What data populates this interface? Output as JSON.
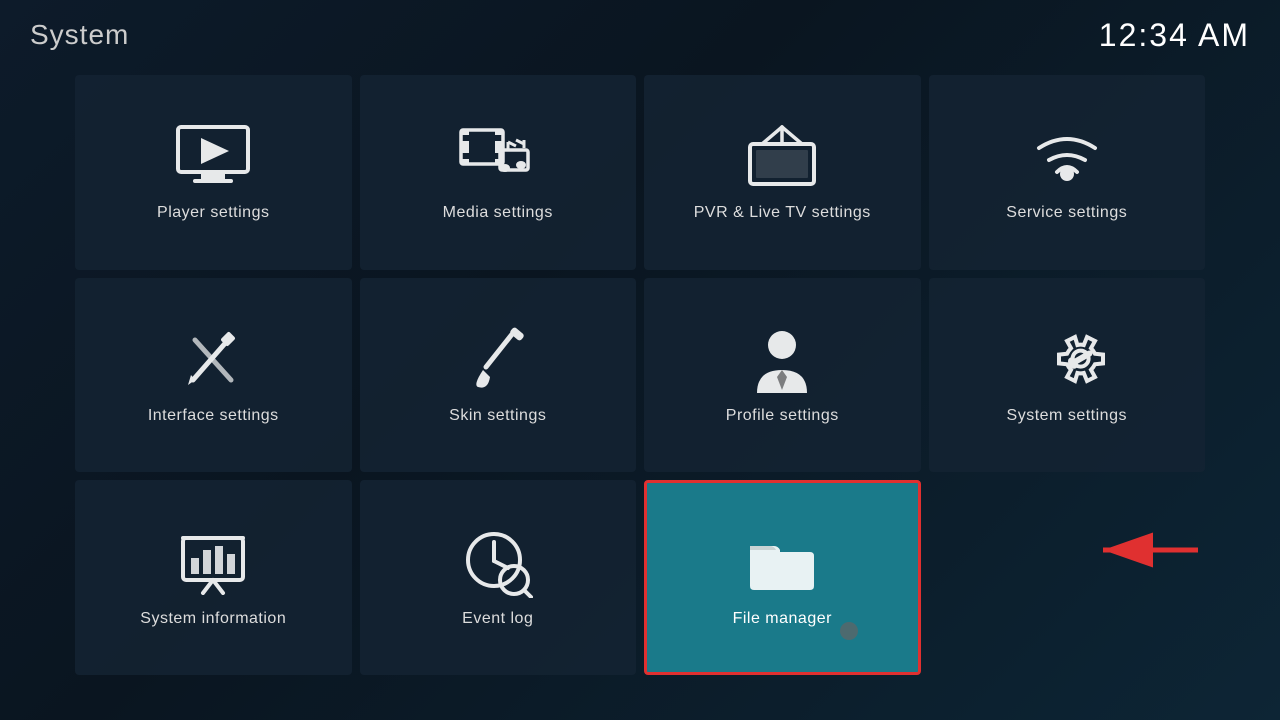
{
  "header": {
    "title": "System",
    "clock": "12:34 AM"
  },
  "tiles": [
    {
      "id": "player-settings",
      "label": "Player settings",
      "icon": "player",
      "highlighted": false
    },
    {
      "id": "media-settings",
      "label": "Media settings",
      "icon": "media",
      "highlighted": false
    },
    {
      "id": "pvr-settings",
      "label": "PVR & Live TV settings",
      "icon": "pvr",
      "highlighted": false
    },
    {
      "id": "service-settings",
      "label": "Service settings",
      "icon": "service",
      "highlighted": false
    },
    {
      "id": "interface-settings",
      "label": "Interface settings",
      "icon": "interface",
      "highlighted": false
    },
    {
      "id": "skin-settings",
      "label": "Skin settings",
      "icon": "skin",
      "highlighted": false
    },
    {
      "id": "profile-settings",
      "label": "Profile settings",
      "icon": "profile",
      "highlighted": false
    },
    {
      "id": "system-settings",
      "label": "System settings",
      "icon": "system",
      "highlighted": false
    },
    {
      "id": "system-information",
      "label": "System information",
      "icon": "sysinfo",
      "highlighted": false
    },
    {
      "id": "event-log",
      "label": "Event log",
      "icon": "eventlog",
      "highlighted": false
    },
    {
      "id": "file-manager",
      "label": "File manager",
      "icon": "filemanager",
      "highlighted": true
    }
  ]
}
